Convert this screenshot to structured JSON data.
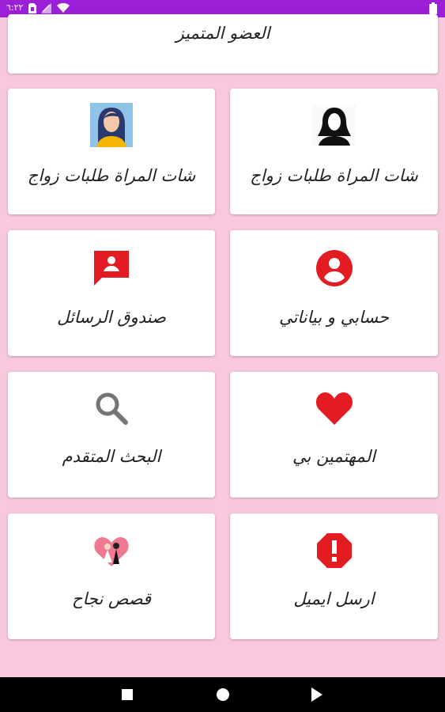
{
  "status_bar": {
    "time": "٦:٢٢"
  },
  "featured": {
    "label": "العضو المتميز"
  },
  "tiles": [
    {
      "label": "شات المراة طلبات زواج",
      "icon": "woman-silhouette-icon"
    },
    {
      "label": "شات المراة طلبات زواج",
      "icon": "woman-avatar-icon"
    },
    {
      "label": "حسابي و بياناتي",
      "icon": "account-circle-icon"
    },
    {
      "label": "صندوق الرسائل",
      "icon": "message-box-icon"
    },
    {
      "label": "المهتمين بي",
      "icon": "heart-icon"
    },
    {
      "label": "البحث المتقدم",
      "icon": "search-icon"
    },
    {
      "label": "ارسل ايميل",
      "icon": "alert-octagon-icon"
    },
    {
      "label": "قصص نجاح",
      "icon": "couple-heart-icon"
    }
  ],
  "colors": {
    "status_bar": "#9b1fd6",
    "background": "#f8c8dc",
    "accent_red": "#e31b23"
  }
}
